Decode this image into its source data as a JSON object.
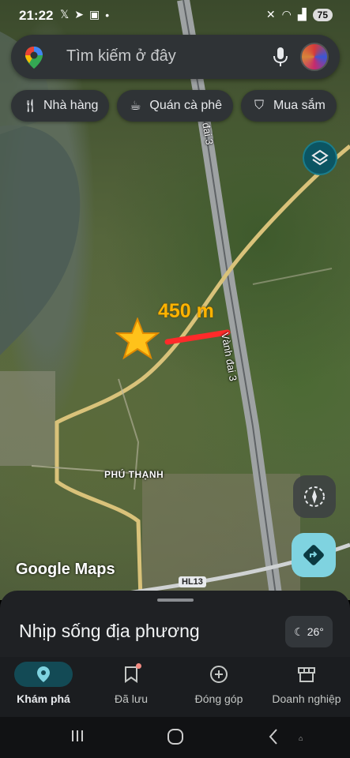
{
  "status_bar": {
    "time": "21:22",
    "left_icons": [
      "x-icon",
      "telegram-icon",
      "screenshot-icon",
      "dot-icon"
    ],
    "right_icons": [
      "mute-icon",
      "wifi-icon",
      "signal-icon"
    ],
    "battery": "75"
  },
  "search": {
    "placeholder": "Tìm kiếm ở đây"
  },
  "chips": [
    {
      "icon": "restaurant-icon",
      "label": "Nhà hàng"
    },
    {
      "icon": "coffee-icon",
      "label": "Quán cà phê"
    },
    {
      "icon": "shopping-bag-icon",
      "label": "Mua sắm"
    }
  ],
  "map": {
    "road_labels": [
      "Vành đai 3",
      "đai 3"
    ],
    "place_label": "PHÚ THẠNH",
    "annotation": "450 m",
    "highway_badge": "HL13",
    "logo": "Google Maps",
    "colors": {
      "annotation": "#ffb300",
      "line": "#ff2a2a",
      "star": "#ffc21a"
    }
  },
  "sheet": {
    "title": "Nhịp sống địa phương",
    "temperature": "26°"
  },
  "nav": [
    {
      "label": "Khám phá",
      "icon": "location-pin-icon",
      "active": true
    },
    {
      "label": "Đã lưu",
      "icon": "bookmark-icon",
      "active": false
    },
    {
      "label": "Đóng góp",
      "icon": "add-circle-icon",
      "active": false
    },
    {
      "label": "Doanh nghiệp",
      "icon": "storefront-icon",
      "active": false
    }
  ]
}
